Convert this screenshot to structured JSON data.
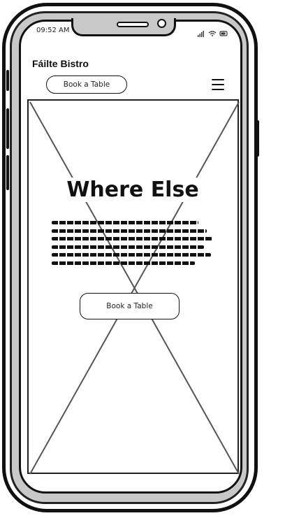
{
  "status_bar": {
    "time": "09:52 AM",
    "icons_text": "│││ ≈ ▭"
  },
  "header": {
    "brand": "Fáilte Bistro",
    "book_label": "Book a Table"
  },
  "hero": {
    "title": "Where Else",
    "book_label": "Book a Table"
  },
  "icons": [
    "menu-icon",
    "signal-icon",
    "wifi-icon",
    "battery-icon",
    "image-placeholder-icon"
  ]
}
